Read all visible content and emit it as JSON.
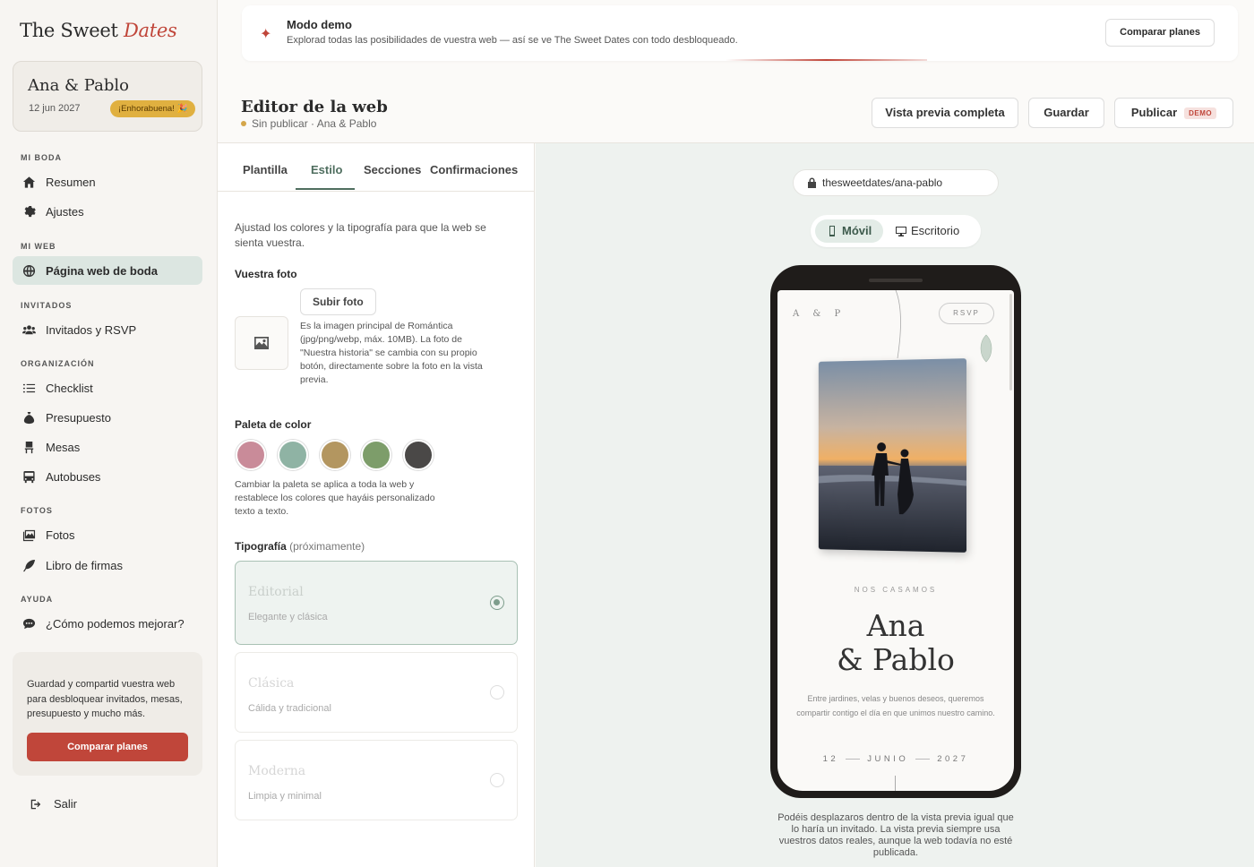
{
  "brand": {
    "name_main": "The Sweet",
    "name_accent": "Dates"
  },
  "couple": {
    "names": "Ana & Pablo",
    "date": "12 jun 2027",
    "badge": "¡Enhorabuena! 🎉"
  },
  "sidebar": {
    "sections": [
      {
        "label": "MI BODA"
      },
      {
        "label": "MI WEB"
      },
      {
        "label": "INVITADOS"
      },
      {
        "label": "ORGANIZACIÓN"
      },
      {
        "label": "FOTOS"
      },
      {
        "label": "AYUDA"
      }
    ],
    "items": [
      {
        "label": "Resumen",
        "icon": "home-icon"
      },
      {
        "label": "Ajustes",
        "icon": "gear-icon"
      },
      {
        "label": "Página web de boda",
        "icon": "globe-icon",
        "active": true
      },
      {
        "label": "Invitados y RSVP",
        "icon": "users-icon"
      },
      {
        "label": "Checklist",
        "icon": "checklist-icon"
      },
      {
        "label": "Presupuesto",
        "icon": "moneybag-icon"
      },
      {
        "label": "Mesas",
        "icon": "chair-icon"
      },
      {
        "label": "Autobuses",
        "icon": "bus-icon"
      },
      {
        "label": "Fotos",
        "icon": "photos-icon"
      },
      {
        "label": "Libro de firmas",
        "icon": "feather-icon"
      },
      {
        "label": "¿Cómo podemos mejorar?",
        "icon": "comment-icon"
      }
    ],
    "promo_text": "Guardad y compartid vuestra web para desbloquear invitados, mesas, presupuesto y mucho más.",
    "promo_button": "Comparar planes",
    "logout": "Salir"
  },
  "banner": {
    "title": "Modo demo",
    "subtitle": "Explorad todas las posibilidades de vuestra web — así se ve The Sweet Dates con todo desbloqueado.",
    "button": "Comparar planes"
  },
  "header": {
    "title": "Editor de la web",
    "status": "Sin publicar",
    "status_suffix": " · Ana & Pablo",
    "buttons": {
      "preview": "Vista previa completa",
      "save": "Guardar",
      "publish": "Publicar",
      "publish_badge": "DEMO"
    }
  },
  "panel": {
    "tabs": [
      "Plantilla",
      "Estilo",
      "Secciones",
      "Confirmaciones"
    ],
    "active_tab": "Estilo",
    "intro": "Ajustad los colores y la tipografía para que la web se sienta vuestra.",
    "photo_label": "Vuestra foto",
    "upload_button": "Subir foto",
    "photo_help": "Es la imagen principal de Romántica (jpg/png/webp, máx. 10MB). La foto de \"Nuestra historia\" se cambia con su propio botón, directamente sobre la foto en la vista previa.",
    "palette_label": "Paleta de color",
    "palette": [
      "#c98b99",
      "#8fb3a4",
      "#b39660",
      "#7d9d6a",
      "#4a4847"
    ],
    "palette_help": "Cambiar la paleta se aplica a toda la web y restablece los colores que hayáis personalizado texto a texto.",
    "typo_label": "Tipografía",
    "typo_soon": "(próximamente)",
    "typography": [
      {
        "name": "Editorial",
        "desc": "Elegante y clásica",
        "selected": true
      },
      {
        "name": "Clásica",
        "desc": "Cálida y tradicional",
        "selected": false
      },
      {
        "name": "Moderna",
        "desc": "Limpia y minimal",
        "selected": false
      }
    ]
  },
  "preview": {
    "url": "thesweetdates/ana-pablo",
    "devices": [
      "Móvil",
      "Escritorio"
    ],
    "active_device": "Móvil",
    "site": {
      "monogram": "A & P",
      "rsvp": "RSVP",
      "eyebrow": "NOS CASAMOS",
      "name1": "Ana",
      "name2": "& Pablo",
      "blurb": "Entre jardines, velas y buenos deseos, queremos compartir contigo el día en que unimos nuestro camino.",
      "day": "12",
      "month": "JUNIO",
      "year": "2027"
    },
    "note": "Podéis desplazaros dentro de la vista previa igual que lo haría un invitado. La vista previa siempre usa vuestros datos reales, aunque la web todavía no esté publicada."
  },
  "colors": {
    "accent": "#c0463a",
    "green": "#4f6e5f",
    "badge": "#e0b040"
  }
}
